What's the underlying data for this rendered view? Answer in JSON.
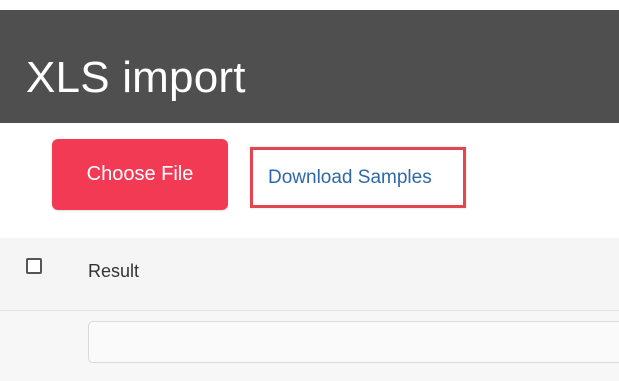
{
  "header": {
    "title": "XLS import"
  },
  "actions": {
    "choose_file_label": "Choose File",
    "download_samples_label": "Download Samples"
  },
  "table": {
    "columns": [
      "Result"
    ],
    "rows": [
      {
        "result_value": "",
        "result_placeholder": ""
      }
    ]
  },
  "colors": {
    "header_bg": "#4f4f4f",
    "primary_button": "#f33a55",
    "highlight_border": "#e2474f",
    "link": "#2f68a8"
  }
}
